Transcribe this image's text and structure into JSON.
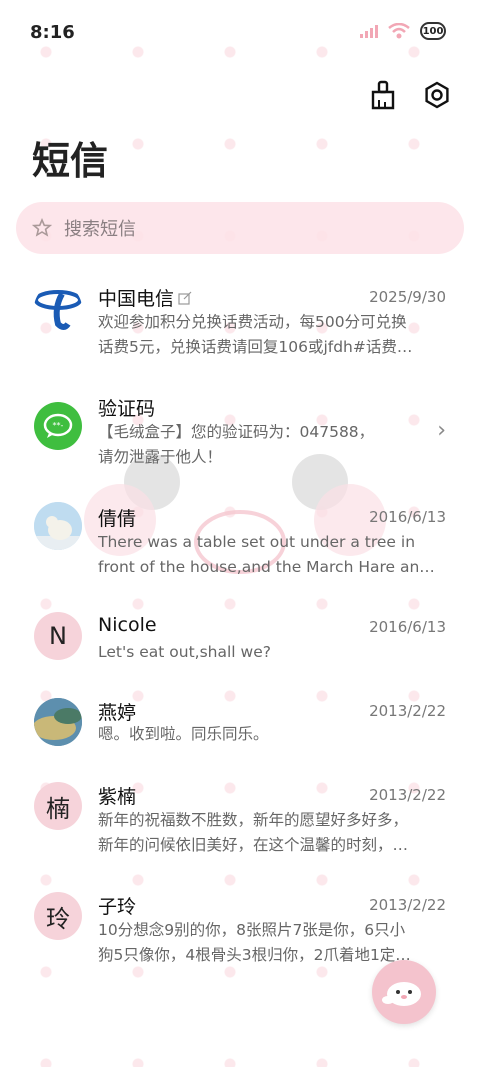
{
  "status": {
    "time": "8:16",
    "battery": "100"
  },
  "header": {
    "title": "短信"
  },
  "search": {
    "placeholder": "搜索短信"
  },
  "conversations": [
    {
      "name": "中国电信",
      "date": "2025/9/30",
      "line1": "欢迎参加积分兑换话费活动，每500分可兑换",
      "line2": "话费5元，兑换话费请回复106或jfdh#话费…"
    },
    {
      "name": "验证码",
      "date": "",
      "line1": "【毛绒盒子】您的验证码为：047588，",
      "line2": "请勿泄露于他人！"
    },
    {
      "name": "倩倩",
      "date": "2016/6/13",
      "line1": "There was a table set out under a tree in",
      "line2": "front of the house,and the March Hare an…"
    },
    {
      "name": "Nicole",
      "avatar": "N",
      "date": "2016/6/13",
      "line1": "Let's eat out,shall we?",
      "line2": ""
    },
    {
      "name": "燕婷",
      "date": "2013/2/22",
      "line1": "嗯。收到啦。同乐同乐。",
      "line2": ""
    },
    {
      "name": "紫楠",
      "avatar": "楠",
      "date": "2013/2/22",
      "line1": "新年的祝福数不胜数，新年的愿望好多好多，",
      "line2": "新年的问候依旧美好，在这个温馨的时刻，…"
    },
    {
      "name": "子玲",
      "avatar": "玲",
      "date": "2013/2/22",
      "line1": "10分想念9别的你，8张照片7张是你，6只小",
      "line2": "狗5只像你，4根骨头3根归你，2爪着地1定…"
    }
  ],
  "colors": {
    "accent": "#f4c3cd",
    "search_bg": "#fde2e8",
    "avatar_bg": "#f6d3da"
  }
}
